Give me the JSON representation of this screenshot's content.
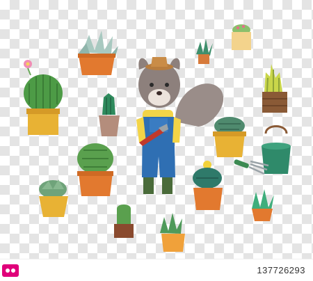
{
  "image": {
    "subjects": [
      "squirrel-gardener",
      "potted-cacti",
      "succulents",
      "watering-can",
      "hand-trowel",
      "hand-rake"
    ]
  },
  "footer": {
    "stock_id": "137726293",
    "logo": "pixta-logo"
  },
  "colors": {
    "checker_light": "#ffffff",
    "checker_dark": "#e4e4e4",
    "squirrel_fur": "#8d807c",
    "overalls": "#2f6fb3",
    "shirt": "#f3d447",
    "watering_can": "#2f8a6a",
    "pot_terracotta": "#e2792f",
    "pot_yellow": "#e8b234"
  }
}
